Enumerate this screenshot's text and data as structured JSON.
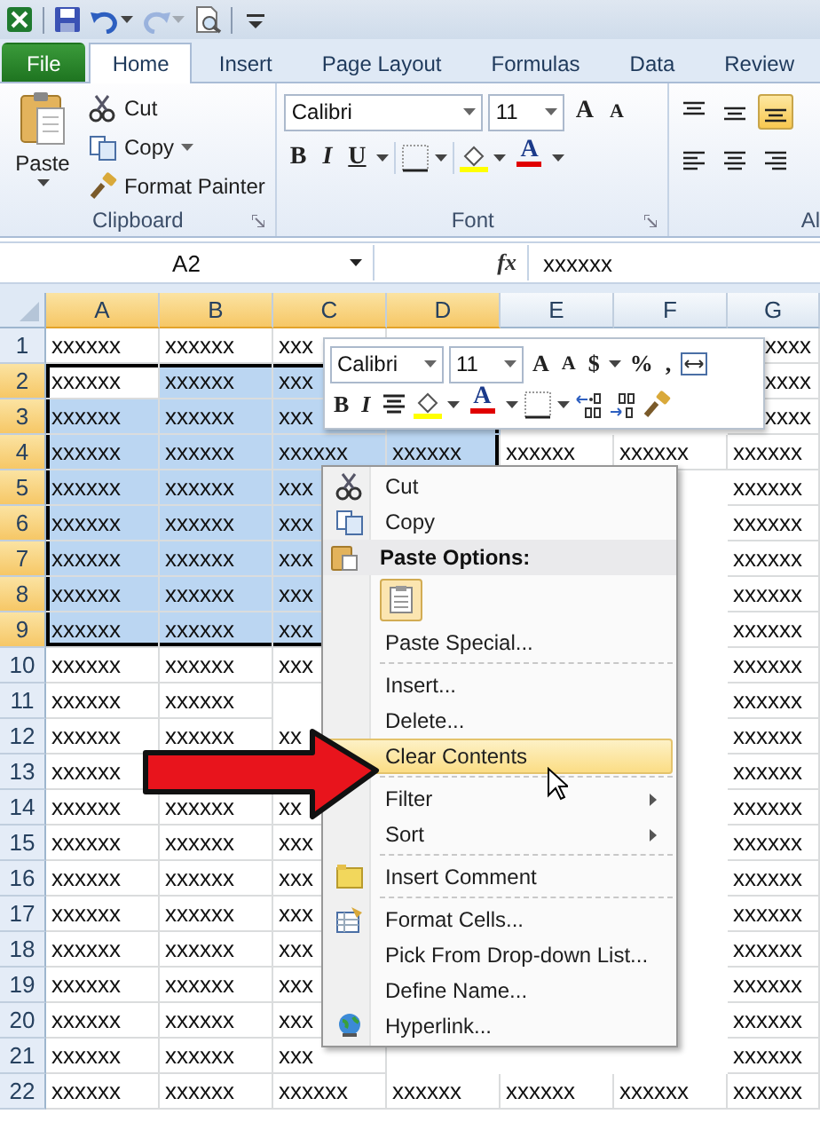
{
  "quick_access": [
    {
      "kind": "logo",
      "disabled": false
    },
    {
      "kind": "save",
      "disabled": false
    },
    {
      "kind": "undo",
      "disabled": false
    },
    {
      "kind": "redo",
      "disabled": true
    },
    {
      "kind": "print-preview",
      "disabled": false
    },
    {
      "kind": "customize",
      "disabled": false
    }
  ],
  "tabs": [
    {
      "label": "File",
      "kind": "file",
      "selected": false
    },
    {
      "label": "Home",
      "kind": "tab",
      "selected": true
    },
    {
      "label": "Insert",
      "kind": "tab",
      "selected": false
    },
    {
      "label": "Page Layout",
      "kind": "tab",
      "selected": false
    },
    {
      "label": "Formulas",
      "kind": "tab",
      "selected": false
    },
    {
      "label": "Data",
      "kind": "tab",
      "selected": false
    },
    {
      "label": "Review",
      "kind": "tab",
      "selected": false
    }
  ],
  "clipboard": {
    "paste": "Paste",
    "cut": "Cut",
    "copy": "Copy",
    "format_painter": "Format Painter",
    "label": "Clipboard"
  },
  "font": {
    "name": "Calibri",
    "size": "11",
    "grow": "A",
    "shrink": "A",
    "bold": "B",
    "italic": "I",
    "underline": "U",
    "color_letter": "A",
    "label": "Font"
  },
  "alignment": {
    "label": "Al",
    "vertical": [
      {
        "kind": "top",
        "selected": false
      },
      {
        "kind": "middle",
        "selected": false
      },
      {
        "kind": "bottom",
        "selected": true
      }
    ],
    "horizontal": [
      {
        "kind": "left",
        "selected": false
      },
      {
        "kind": "center",
        "selected": false
      },
      {
        "kind": "right",
        "selected": false
      }
    ]
  },
  "formula_bar": {
    "name_box": "A2",
    "fx": "fx",
    "value": "xxxxxx"
  },
  "columns": [
    {
      "label": "A",
      "selected": true
    },
    {
      "label": "B",
      "selected": true
    },
    {
      "label": "C",
      "selected": true
    },
    {
      "label": "D",
      "selected": true
    },
    {
      "label": "E",
      "selected": false
    },
    {
      "label": "F",
      "selected": false
    },
    {
      "label": "G",
      "selected": false
    }
  ],
  "rows": [
    {
      "label": "1",
      "selected": false,
      "cells": {
        "A": "xxxxxx",
        "B": "xxxxxx",
        "C": "xxx",
        "G": "xxxx"
      }
    },
    {
      "label": "2",
      "selected": true,
      "cells": {
        "A": "xxxxxx",
        "B": "xxxxxx",
        "C": "xxx",
        "G": "xxxx"
      }
    },
    {
      "label": "3",
      "selected": true,
      "cells": {
        "A": "xxxxxx",
        "B": "xxxxxx",
        "C": "xxx",
        "G": "xxxx"
      }
    },
    {
      "label": "4",
      "selected": true,
      "cells": {
        "A": "xxxxxx",
        "B": "xxxxxx",
        "C": "xxxxxx",
        "D": "xxxxxx",
        "E": "xxxxxx",
        "F": "xxxxxx",
        "G": "xxxxxx"
      }
    },
    {
      "label": "5",
      "selected": true,
      "cells": {
        "A": "xxxxxx",
        "B": "xxxxxx",
        "C": "xxx",
        "G": "xxxxxx"
      }
    },
    {
      "label": "6",
      "selected": true,
      "cells": {
        "A": "xxxxxx",
        "B": "xxxxxx",
        "C": "xxx",
        "G": "xxxxxx"
      }
    },
    {
      "label": "7",
      "selected": true,
      "cells": {
        "A": "xxxxxx",
        "B": "xxxxxx",
        "C": "xxx",
        "G": "xxxxxx"
      }
    },
    {
      "label": "8",
      "selected": true,
      "cells": {
        "A": "xxxxxx",
        "B": "xxxxxx",
        "C": "xxx",
        "G": "xxxxxx"
      }
    },
    {
      "label": "9",
      "selected": true,
      "cells": {
        "A": "xxxxxx",
        "B": "xxxxxx",
        "C": "xxx",
        "G": "xxxxxx"
      }
    },
    {
      "label": "10",
      "selected": false,
      "cells": {
        "A": "xxxxxx",
        "B": "xxxxxx",
        "C": "xxx",
        "G": "xxxxxx"
      }
    },
    {
      "label": "11",
      "selected": false,
      "cells": {
        "A": "xxxxxx",
        "B": "xxxxxx",
        "G": "xxxxxx"
      }
    },
    {
      "label": "12",
      "selected": false,
      "cells": {
        "A": "xxxxxx",
        "B": "xxxxxx",
        "C": "xx",
        "G": "xxxxxx"
      }
    },
    {
      "label": "13",
      "selected": false,
      "cells": {
        "A": "xxxxxx",
        "G": "xxxxxx"
      }
    },
    {
      "label": "14",
      "selected": false,
      "cells": {
        "A": "xxxxxx",
        "B": "xxxxxx",
        "C": "xx",
        "G": "xxxxxx"
      }
    },
    {
      "label": "15",
      "selected": false,
      "cells": {
        "A": "xxxxxx",
        "B": "xxxxxx",
        "C": "xxx",
        "G": "xxxxxx"
      }
    },
    {
      "label": "16",
      "selected": false,
      "cells": {
        "A": "xxxxxx",
        "B": "xxxxxx",
        "C": "xxx",
        "G": "xxxxxx"
      }
    },
    {
      "label": "17",
      "selected": false,
      "cells": {
        "A": "xxxxxx",
        "B": "xxxxxx",
        "C": "xxx",
        "G": "xxxxxx"
      }
    },
    {
      "label": "18",
      "selected": false,
      "cells": {
        "A": "xxxxxx",
        "B": "xxxxxx",
        "C": "xxx",
        "G": "xxxxxx"
      }
    },
    {
      "label": "19",
      "selected": false,
      "cells": {
        "A": "xxxxxx",
        "B": "xxxxxx",
        "C": "xxx",
        "G": "xxxxxx"
      }
    },
    {
      "label": "20",
      "selected": false,
      "cells": {
        "A": "xxxxxx",
        "B": "xxxxxx",
        "C": "xxx",
        "G": "xxxxxx"
      }
    },
    {
      "label": "21",
      "selected": false,
      "cells": {
        "A": "xxxxxx",
        "B": "xxxxxx",
        "C": "xxx",
        "G": "xxxxxx"
      }
    },
    {
      "label": "22",
      "selected": false,
      "cells": {
        "A": "xxxxxx",
        "B": "xxxxxx",
        "C": "xxxxxx",
        "D": "xxxxxx",
        "E": "xxxxxx",
        "F": "xxxxxx",
        "G": "xxxxxx"
      }
    }
  ],
  "mini_toolbar": {
    "font": "Calibri",
    "size": "11",
    "grow": "A",
    "shrink": "A",
    "currency": "$",
    "percent": "%",
    "comma": ",",
    "bold": "B",
    "italic": "I",
    "color_letter": "A"
  },
  "context_menu": [
    {
      "kind": "item",
      "label": "Cut",
      "selected": false,
      "submenu": false
    },
    {
      "kind": "item",
      "label": "Copy",
      "selected": false,
      "submenu": false
    },
    {
      "kind": "header",
      "label": "Paste Options:"
    },
    {
      "kind": "paste-buttons"
    },
    {
      "kind": "item",
      "label": "Paste Special...",
      "selected": false,
      "submenu": false
    },
    {
      "kind": "separator"
    },
    {
      "kind": "item",
      "label": "Insert...",
      "selected": false,
      "submenu": false
    },
    {
      "kind": "item",
      "label": "Delete...",
      "selected": false,
      "submenu": false
    },
    {
      "kind": "item",
      "label": "Clear Contents",
      "selected": true,
      "submenu": false
    },
    {
      "kind": "separator"
    },
    {
      "kind": "item",
      "label": "Filter",
      "selected": false,
      "submenu": true
    },
    {
      "kind": "item",
      "label": "Sort",
      "selected": false,
      "submenu": true
    },
    {
      "kind": "separator"
    },
    {
      "kind": "item",
      "label": "Insert Comment",
      "selected": false,
      "submenu": false
    },
    {
      "kind": "separator"
    },
    {
      "kind": "item",
      "label": "Format Cells...",
      "selected": false,
      "submenu": false
    },
    {
      "kind": "item",
      "label": "Pick From Drop-down List...",
      "selected": false,
      "submenu": false
    },
    {
      "kind": "item",
      "label": "Define Name...",
      "selected": false,
      "submenu": false
    },
    {
      "kind": "item",
      "label": "Hyperlink...",
      "selected": false,
      "submenu": false
    }
  ]
}
